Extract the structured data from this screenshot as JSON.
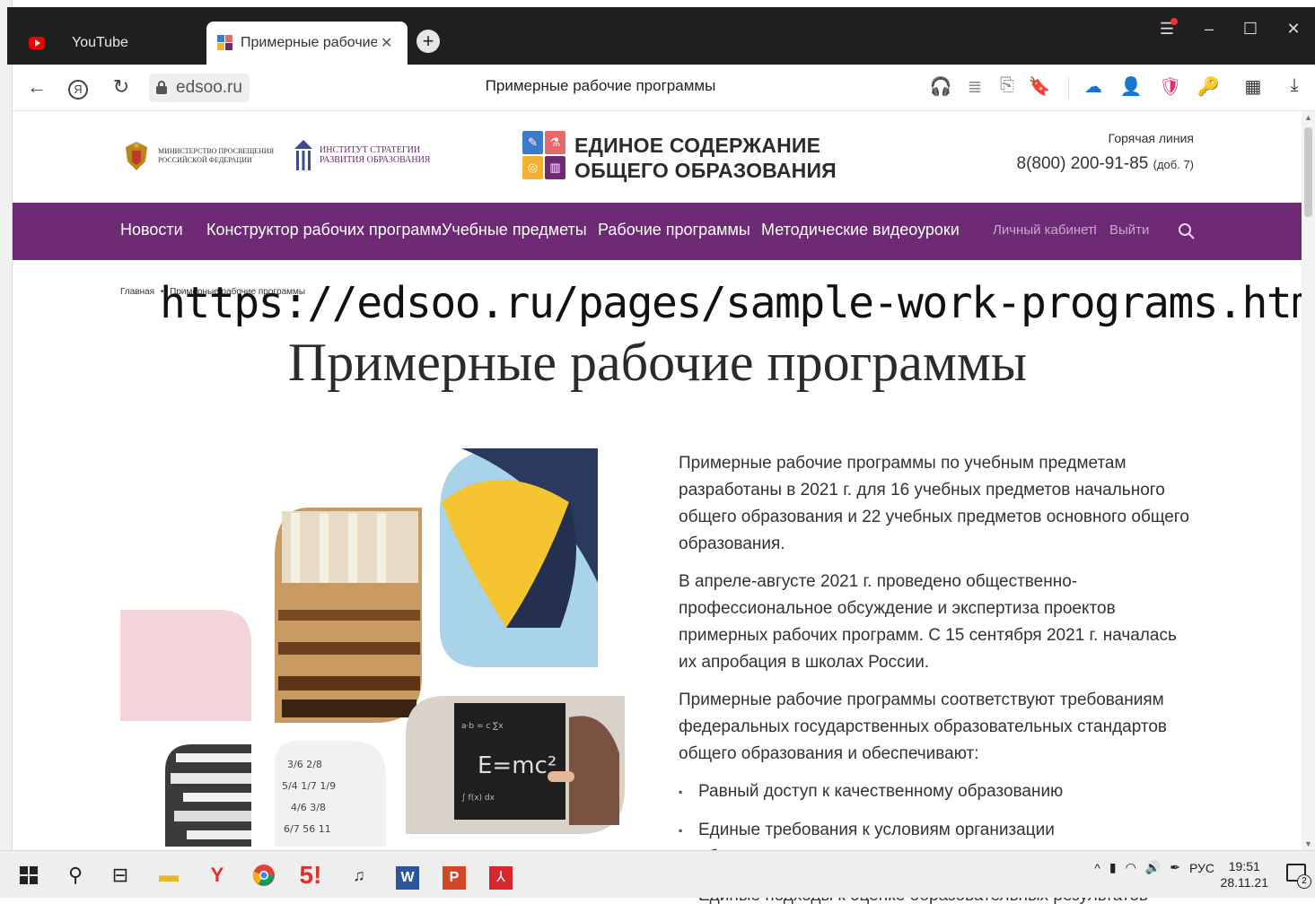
{
  "browser": {
    "tabs": [
      {
        "label": "YouTube",
        "icon": "youtube-icon"
      },
      {
        "label": "Примерные рабочие п",
        "icon": "site-favicon-icon",
        "active": true
      }
    ],
    "new_tab_icon": "plus-icon",
    "address": {
      "domain": "edsoo.ru",
      "page_title": "Примерные рабочие программы"
    },
    "window_controls": [
      "menu-icon",
      "minimize-icon",
      "maximize-icon",
      "close-icon"
    ]
  },
  "site": {
    "header": {
      "ministry_lines": [
        "МИНИСТЕРСТВО ПРОСВЕЩЕНИЯ",
        "РОССИЙСКОЙ ФЕДЕРАЦИИ"
      ],
      "institute_lines": [
        "ИНСТИТУТ СТРАТЕГИИ",
        "РАЗВИТИЯ ОБРАЗОВАНИЯ"
      ],
      "brand_line1": "ЕДИНОЕ СОДЕРЖАНИЕ",
      "brand_line2": "ОБЩЕГО ОБРАЗОВАНИЯ",
      "hotline_label": "Горячая линия",
      "hotline_phone": "8(800) 200-91-85",
      "hotline_ext": "(доб. 7)"
    },
    "nav": {
      "items": [
        "Новости",
        "Конструктор рабочих программ",
        "Учебные предметы",
        "Рабочие программы",
        "Методические видеоуроки"
      ],
      "cabinet": "Личный кабинет",
      "separator": "I",
      "logout": "Выйти"
    },
    "breadcrumb": {
      "home": "Главная",
      "sep": "•",
      "current": "Примерные рабочие программы"
    },
    "url_overlay": "https://edsoo.ru/pages/sample-work-programs.html",
    "page_title": "Примерные рабочие программы",
    "paragraphs": [
      "Примерные рабочие программы по учебным предметам разработаны в 2021 г. для 16 учебных предметов начального общего образования и 22 учебных предметов основного общего образования.",
      "В апреле-августе 2021 г. проведено общественно-профессиональное обсуждение и экспертиза проектов примерных рабочих программ. С 15 сентября 2021 г. началась их апробация в школах России.",
      "Примерные рабочие программы соответствуют требованиям федеральных государственных образовательных стандартов общего образования и обеспечивают:"
    ],
    "bullets": [
      "Равный доступ к качественному образованию",
      "Единые требования к условиям организации образовательного процесса",
      "Единые подходы к оценке образовательных результатов"
    ]
  },
  "taskbar": {
    "language": "РУС",
    "time": "19:51",
    "date": "28.11.21",
    "notification_count": "2"
  },
  "colors": {
    "brand_purple": "#6e2a74",
    "tab_bar": "#1f1f1f"
  }
}
